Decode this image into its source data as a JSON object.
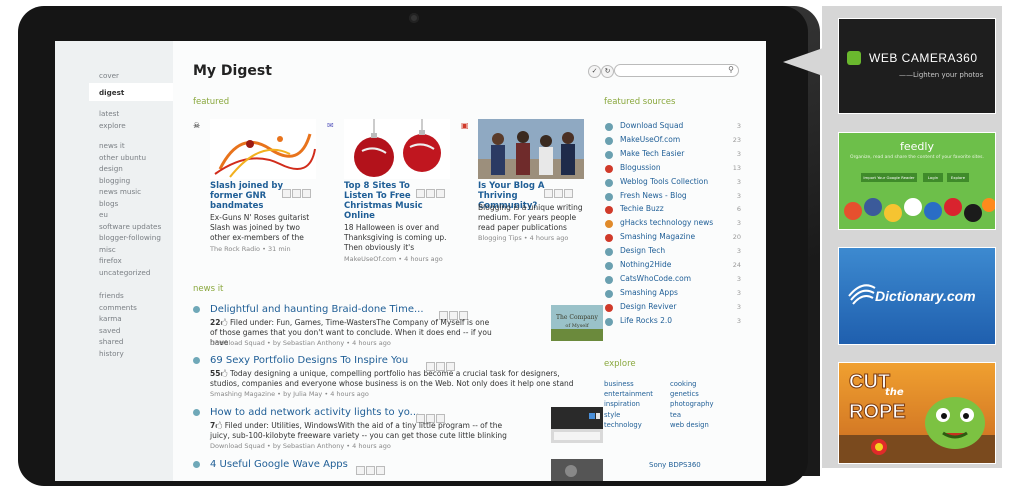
{
  "nav": {
    "top": [
      "cover",
      "digest"
    ],
    "group1": [
      "latest",
      "explore"
    ],
    "group2": [
      "news it",
      "other ubuntu",
      "design",
      "blogging",
      "news music",
      "blogs",
      "eu",
      "software updates",
      "blogger-following",
      "misc",
      "firefox",
      "uncategorized"
    ],
    "group3": [
      "friends",
      "comments",
      "karma",
      "saved",
      "shared",
      "history"
    ]
  },
  "page": {
    "title": "My Digest"
  },
  "sections": {
    "featured": "featured",
    "news_it": "news it",
    "featured_sources": "featured sources",
    "explore": "explore"
  },
  "featured": [
    {
      "title": "Slash joined by former GNR bandmates",
      "snippet": "Ex-Guns N' Roses guitarist Slash was joined by two other ex-members of the",
      "source": "The Rock Radio",
      "time": "31 min",
      "icon": "skull-icon"
    },
    {
      "title": "Top 8 Sites To Listen To Free Christmas Music Online",
      "snippet": "18 Halloween is over and Thanksgiving is coming up. Then obviously it's",
      "source": "MakeUseOf.com",
      "time": "4 hours ago",
      "icon": "makeuseof-icon"
    },
    {
      "title": "Is Your Blog A Thriving Community?",
      "snippet": "Blogging is a unique writing medium. For years people read paper publications",
      "source": "Blogging Tips",
      "time": "4 hours ago",
      "icon": "blogging-tips-icon"
    }
  ],
  "news": [
    {
      "title": "Delightful and haunting Braid-done Time...",
      "count": "22",
      "snippet": "Filed under: Fun, Games, Time-WastersThe Company of Myself is one of those games that you don't want to conclude. When it does end -- if you have",
      "source": "Download Squad",
      "author": "Sebastian Anthony",
      "time": "4 hours ago"
    },
    {
      "title": "69 Sexy Portfolio Designs To Inspire You",
      "count": "55",
      "snippet": "Today designing a unique, compelling portfolio has become a crucial task for designers, studios, companies and everyone whose business is on the Web. Not only does it help one stand",
      "source": "Smashing Magazine",
      "author": "Julia May",
      "time": "4 hours ago"
    },
    {
      "title": "How to add network activity lights to yo...",
      "count": "7",
      "snippet": "Filed under: Utilities, WindowsWith the aid of a tiny little program -- of the juicy, sub-100-kilobyte freeware variety -- you can get those cute little blinking",
      "source": "Download Squad",
      "author": "Sebastian Anthony",
      "time": "4 hours ago"
    },
    {
      "title": "4 Useful Google Wave Apps",
      "count": "",
      "snippet": "",
      "source": "",
      "author": "",
      "time": ""
    }
  ],
  "sources": [
    {
      "name": "Download Squad",
      "count": "3",
      "color": "#6aa0b0"
    },
    {
      "name": "MakeUseOf.com",
      "count": "23",
      "color": "#6aa0b0"
    },
    {
      "name": "Make Tech Easier",
      "count": "3",
      "color": "#6aa0b0"
    },
    {
      "name": "Blogussion",
      "count": "13",
      "color": "#d03a2a"
    },
    {
      "name": "Weblog Tools Collection",
      "count": "3",
      "color": "#6aa0b0"
    },
    {
      "name": "Fresh News - Blog",
      "count": "3",
      "color": "#6aa0b0"
    },
    {
      "name": "Techie Buzz",
      "count": "6",
      "color": "#d03a2a"
    },
    {
      "name": "gHacks technology news",
      "count": "3",
      "color": "#e08a2a"
    },
    {
      "name": "Smashing Magazine",
      "count": "20",
      "color": "#d03a2a"
    },
    {
      "name": "Design Tech",
      "count": "3",
      "color": "#6aa0b0"
    },
    {
      "name": "Nothing2Hide",
      "count": "24",
      "color": "#6aa0b0"
    },
    {
      "name": "CatsWhoCode.com",
      "count": "3",
      "color": "#6aa0b0"
    },
    {
      "name": "Smashing Apps",
      "count": "3",
      "color": "#6aa0b0"
    },
    {
      "name": "Design Reviver",
      "count": "3",
      "color": "#d03a2a"
    },
    {
      "name": "Life Rocks 2.0",
      "count": "3",
      "color": "#6aa0b0"
    }
  ],
  "explore": {
    "col1": [
      "business",
      "entertainment",
      "inspiration",
      "style",
      "technology"
    ],
    "col2": [
      "cooking",
      "genetics",
      "photography",
      "tea",
      "web design"
    ]
  },
  "sony": "Sony BDPS360",
  "ads": {
    "webcam": {
      "title": "WEB CAMERA360",
      "tagline": "——Lighten your photos"
    },
    "feedly": {
      "title": "feedly",
      "subtitle": "Organize, read and share the content of your favorite sites.",
      "btn1": "Import Your Google Reader",
      "btn2": "Login",
      "btn3": "Explore"
    },
    "dictionary": {
      "title": "Dictionary.com"
    },
    "cuttherope": {
      "line1": "CUT",
      "line2": "the",
      "line3": "ROPE"
    }
  },
  "colors": {
    "accent_green": "#8aa83e",
    "link_blue": "#1f5e96"
  }
}
